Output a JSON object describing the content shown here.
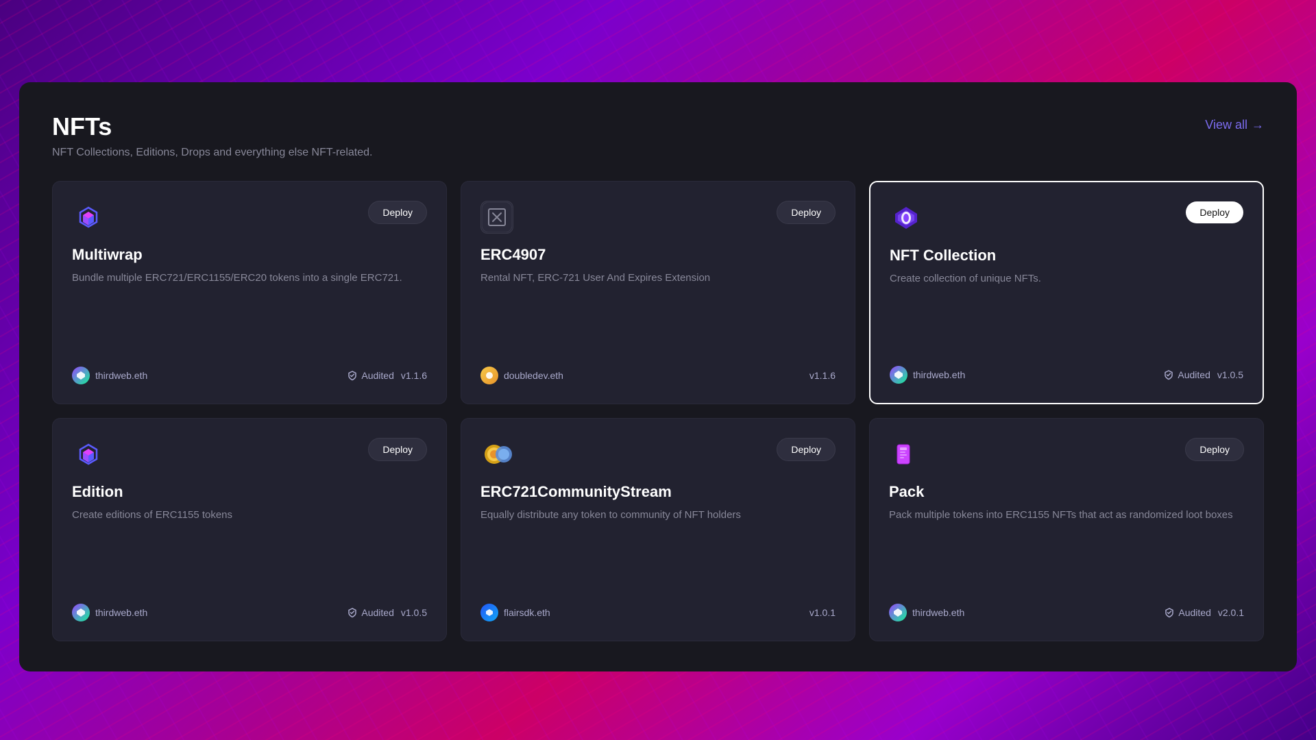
{
  "background": {
    "colors": [
      "#4a0080",
      "#7b00cc",
      "#cc0066",
      "#9900cc",
      "#440088"
    ]
  },
  "panel": {
    "title": "NFTs",
    "subtitle": "NFT Collections, Editions, Drops and everything else NFT-related.",
    "view_all_label": "View all"
  },
  "cards": [
    {
      "id": "multiwrap",
      "title": "Multiwrap",
      "description": "Bundle multiple ERC721/ERC1155/ERC20 tokens into a single ERC721.",
      "author": "thirdweb.eth",
      "audited": true,
      "version": "v1.1.6",
      "deploy_label": "Deploy",
      "highlighted": false,
      "icon_type": "multiwrap"
    },
    {
      "id": "erc4907",
      "title": "ERC4907",
      "description": "Rental NFT, ERC-721 User And Expires Extension",
      "author": "doubledev.eth",
      "audited": false,
      "version": "v1.1.6",
      "deploy_label": "Deploy",
      "highlighted": false,
      "icon_type": "erc4907"
    },
    {
      "id": "nft-collection",
      "title": "NFT Collection",
      "description": "Create collection of unique NFTs.",
      "author": "thirdweb.eth",
      "audited": true,
      "version": "v1.0.5",
      "deploy_label": "Deploy",
      "highlighted": true,
      "icon_type": "nft-collection"
    },
    {
      "id": "edition",
      "title": "Edition",
      "description": "Create editions of ERC1155 tokens",
      "author": "thirdweb.eth",
      "audited": true,
      "version": "v1.0.5",
      "deploy_label": "Deploy",
      "highlighted": false,
      "icon_type": "edition"
    },
    {
      "id": "erc721communitystream",
      "title": "ERC721CommunityStream",
      "description": "Equally distribute any token to community of NFT holders",
      "author": "flairsdk.eth",
      "audited": false,
      "version": "v1.0.1",
      "deploy_label": "Deploy",
      "highlighted": false,
      "icon_type": "community-stream"
    },
    {
      "id": "pack",
      "title": "Pack",
      "description": "Pack multiple tokens into ERC1155 NFTs that act as randomized loot boxes",
      "author": "thirdweb.eth",
      "audited": true,
      "version": "v2.0.1",
      "deploy_label": "Deploy",
      "highlighted": false,
      "icon_type": "pack"
    }
  ]
}
